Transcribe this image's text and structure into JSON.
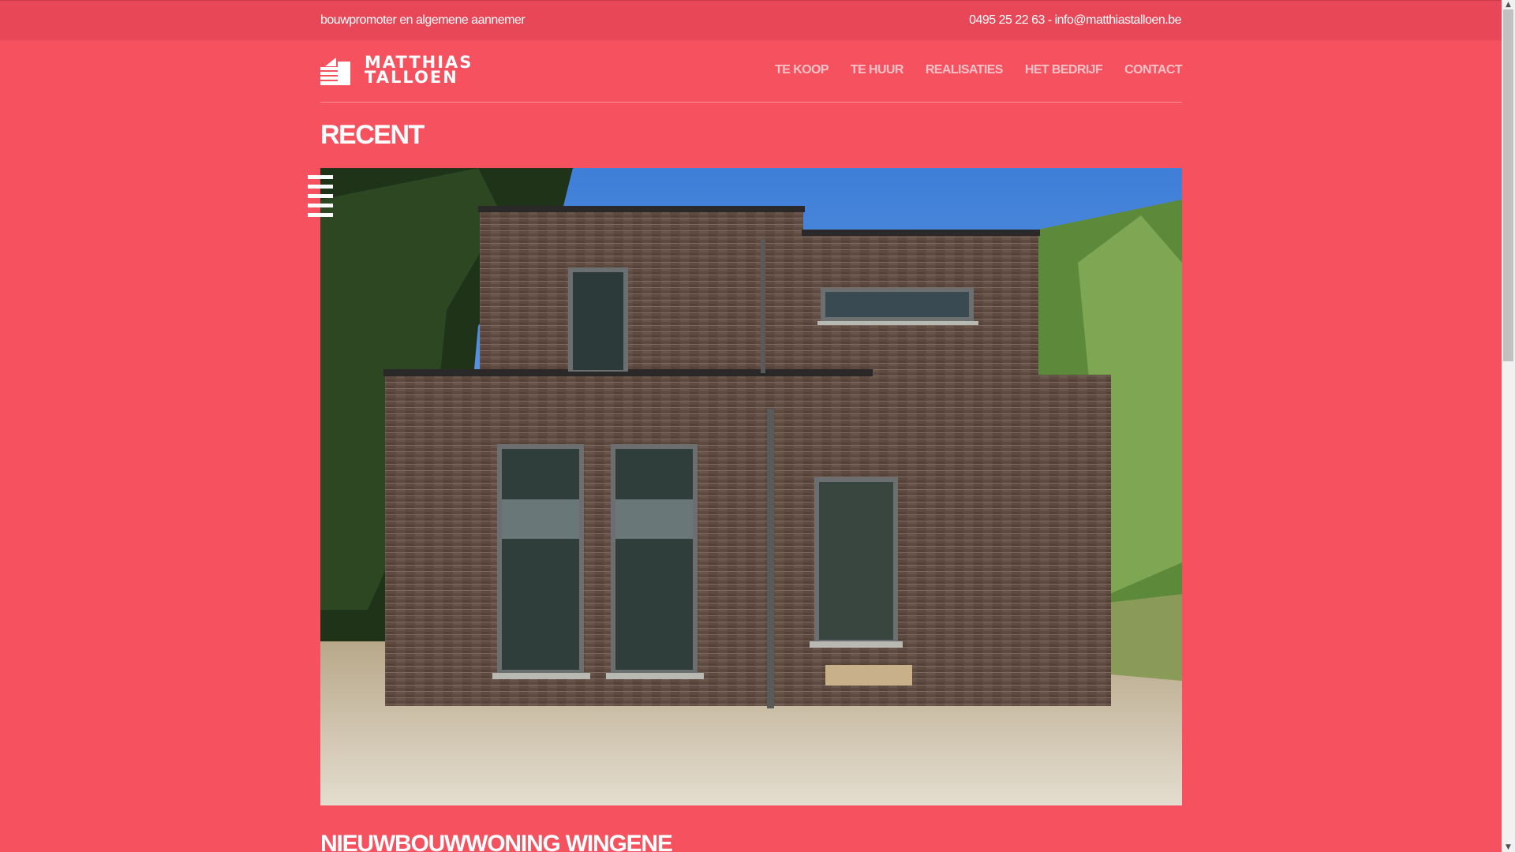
{
  "topbar": {
    "tagline": "bouwpromoter en algemene aannemer",
    "contact": "0495 25 22 63 - info@matthiastalloen.be"
  },
  "brand": {
    "line1": "MATTHIAS",
    "line2": "TALLOEN",
    "logo_icon": "building-stack-icon"
  },
  "nav": {
    "items": [
      {
        "label": "TE KOOP"
      },
      {
        "label": "TE HUUR"
      },
      {
        "label": "REALISATIES"
      },
      {
        "label": "HET BEDRIJF"
      },
      {
        "label": "CONTACT"
      }
    ]
  },
  "main": {
    "section_title": "RECENT",
    "project_title": "NIEUWBOUWWONING WINGENE",
    "hero_icon": "house-photo"
  },
  "colors": {
    "background": "#f5515f",
    "topbar": "#e74757",
    "nav_text": "#fbc3c8",
    "text": "#ffffff"
  }
}
